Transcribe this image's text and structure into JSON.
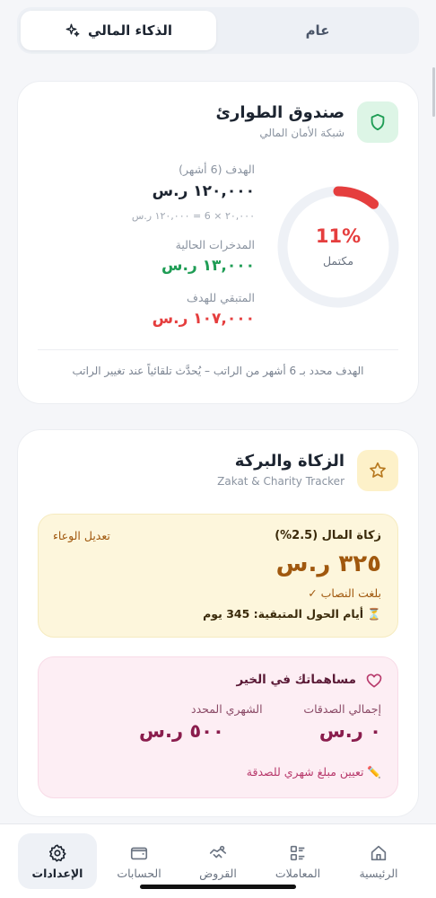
{
  "tabs": {
    "active_label": "الذكاء المالي",
    "other_label": "عام"
  },
  "emergency": {
    "title": "صندوق الطوارئ",
    "subtitle": "شبكة الأمان المالي",
    "goal_label": "الهدف (6 أشهر)",
    "goal_value": "١٢٠,٠٠٠ ر.س",
    "goal_formula": "٢٠,٠٠٠ × 6 = ١٢٠,٠٠٠ ر.س",
    "savings_label": "المدخرات الحالية",
    "savings_value": "١٣,٠٠٠ ر.س",
    "remaining_label": "المتبقي للهدف",
    "remaining_value": "١٠٧,٠٠٠ ر.س",
    "progress_text": "11%",
    "progress": 0.11,
    "progress_label": "مكتمل",
    "footnote": "الهدف محدد بـ 6 أشهر من الراتب – يُحدَّث تلقائياً عند تغيير الراتب"
  },
  "zakat": {
    "title": "الزكاة والبركة",
    "subtitle": "Zakat & Charity Tracker",
    "mal_label": "زكاة المال (2.5%)",
    "edit_label": "تعديل الوعاء",
    "mal_value": "٣٢٥ ر.س",
    "nisab_text": "بلغت النصاب ✓",
    "hawl_text": "⏳ أيام الحول المتبقية: 345 يوم",
    "contrib_title": "مساهماتك في الخير",
    "total_label": "إجمالي الصدقات",
    "total_value": "٠ ر.س",
    "monthly_label": "الشهري المحدد",
    "monthly_value": "٥٠٠ ر.س",
    "set_monthly": "✏️ تعيين مبلغ شهري للصدقة"
  },
  "nav": {
    "home": "الرئيسية",
    "transactions": "المعاملات",
    "loans": "القروض",
    "accounts": "الحسابات",
    "settings": "الإعدادات"
  },
  "colors": {
    "green": "#1f9d55",
    "red": "#e53e3e",
    "zakat_brown": "#a0580e",
    "pink_text": "#8a1d4d",
    "ring_track": "#eef1f6"
  }
}
